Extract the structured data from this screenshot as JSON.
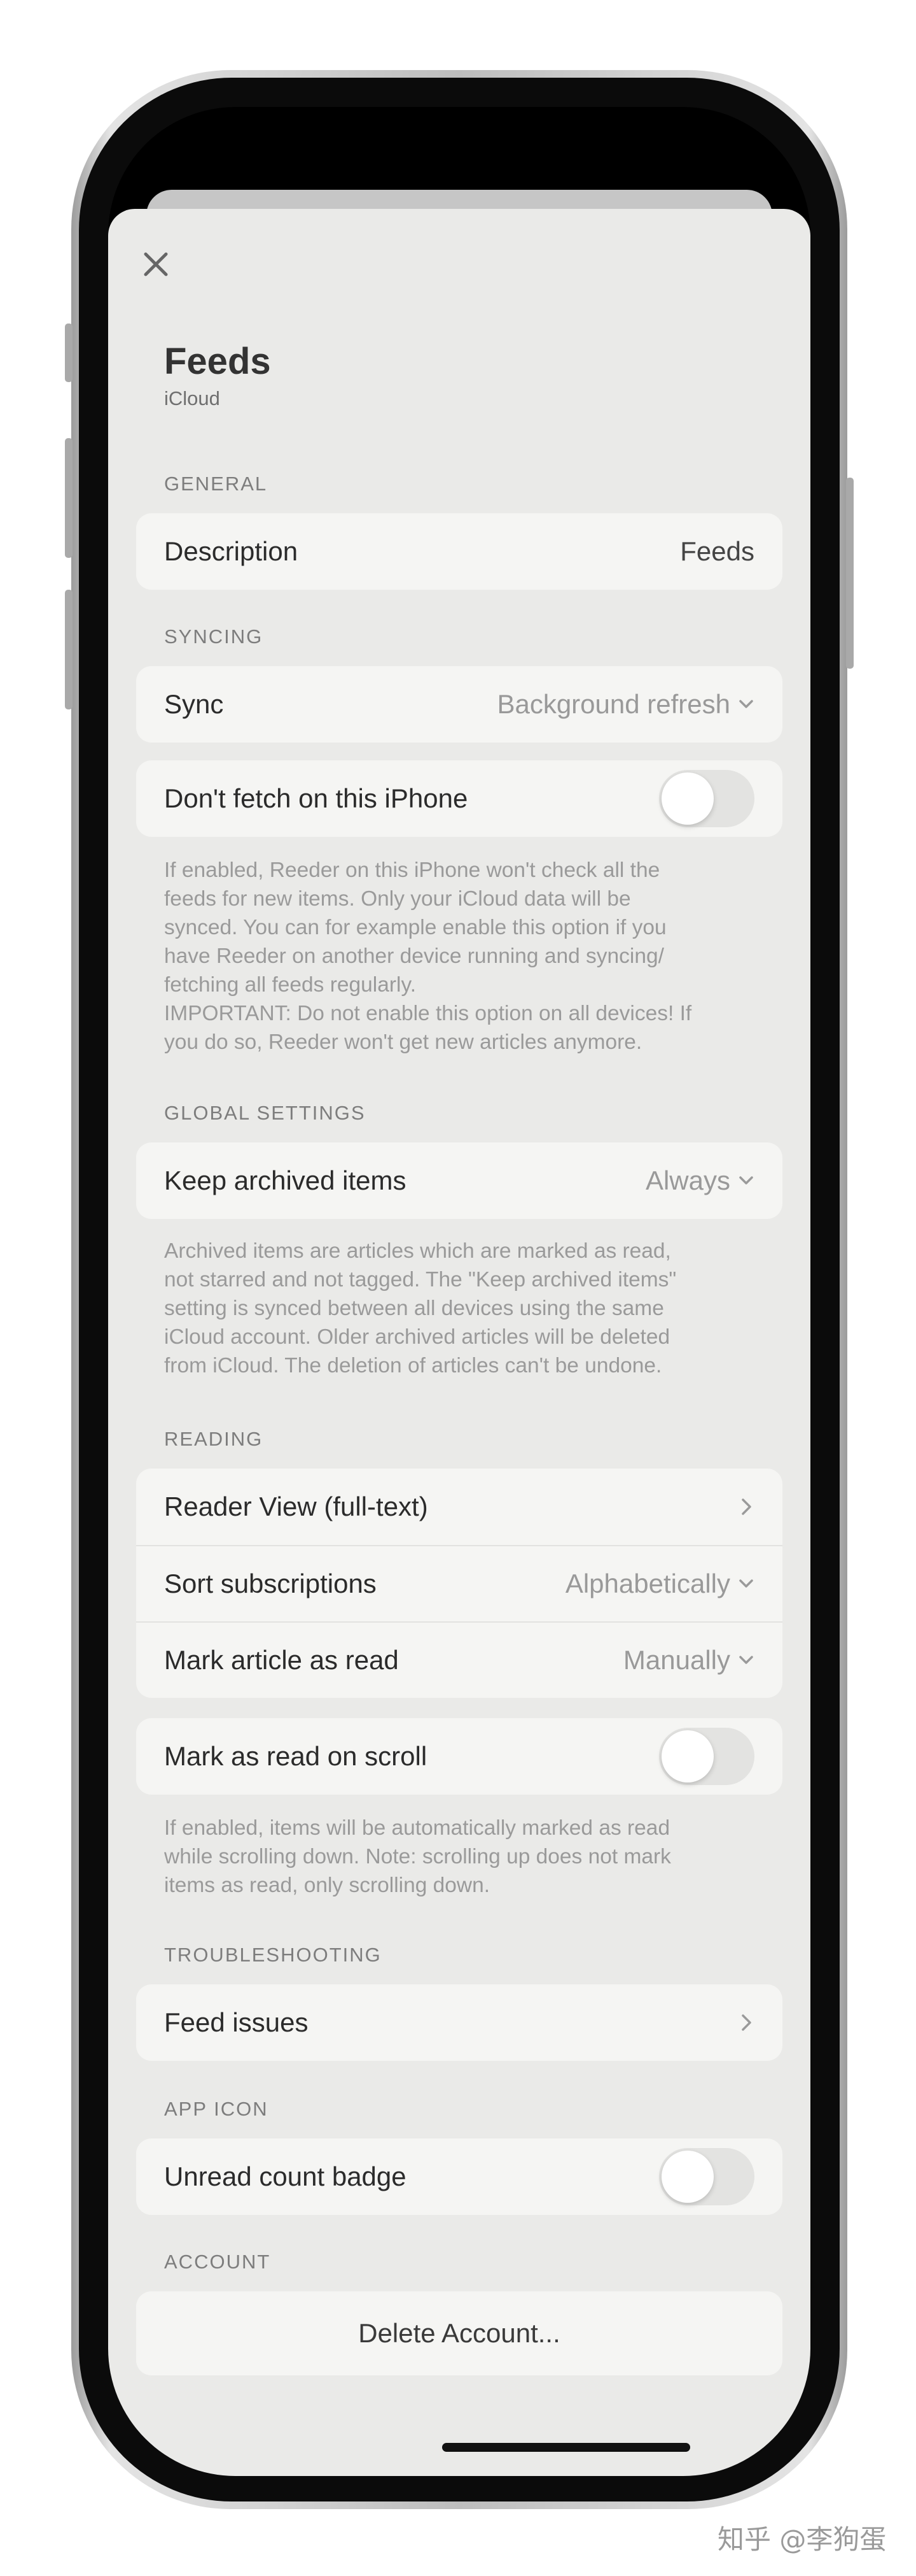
{
  "sheet": {
    "close_icon": "close-icon",
    "title": "Feeds",
    "subtitle": "iCloud"
  },
  "sections": {
    "general": {
      "label": "GENERAL",
      "description_label": "Description",
      "description_value": "Feeds"
    },
    "syncing": {
      "label": "SYNCING",
      "sync_label": "Sync",
      "sync_value": "Background refresh",
      "dont_fetch_label": "Don't fetch on this iPhone",
      "dont_fetch_on": false,
      "footer": "If enabled, Reeder on this iPhone won't check all the\nfeeds for new items. Only your iCloud data will be\nsynced. You can for example enable this option if you\nhave Reeder on another device running and syncing/\nfetching all feeds regularly.\nIMPORTANT: Do not enable this option on all devices! If\nyou do so, Reeder won't get new articles anymore."
    },
    "global_settings": {
      "label": "GLOBAL SETTINGS",
      "keep_archived_label": "Keep archived items",
      "keep_archived_value": "Always",
      "footer": "Archived items are articles which are marked as read,\nnot starred and not tagged. The \"Keep archived items\"\nsetting is synced between all devices using the same\niCloud account. Older archived articles will be deleted\nfrom iCloud. The deletion of articles can't be undone."
    },
    "reading": {
      "label": "READING",
      "reader_view_label": "Reader View (full-text)",
      "sort_label": "Sort subscriptions",
      "sort_value": "Alphabetically",
      "mark_read_label": "Mark article as read",
      "mark_read_value": "Manually",
      "mark_scroll_label": "Mark as read on scroll",
      "mark_scroll_on": false,
      "footer": "If enabled, items will be automatically marked as read\nwhile scrolling down. Note: scrolling up does not mark\nitems as read, only scrolling down."
    },
    "troubleshooting": {
      "label": "TROUBLESHOOTING",
      "feed_issues_label": "Feed issues"
    },
    "app_icon": {
      "label": "APP ICON",
      "badge_label": "Unread count badge",
      "badge_on": false
    },
    "account": {
      "label": "ACCOUNT",
      "delete_label": "Delete Account..."
    }
  },
  "watermark": "知乎 @李狗蛋",
  "colors": {
    "sheet_background": "#eaeae8",
    "card_background": "#f5f5f3",
    "toggle_off": "#e3e3e1"
  }
}
